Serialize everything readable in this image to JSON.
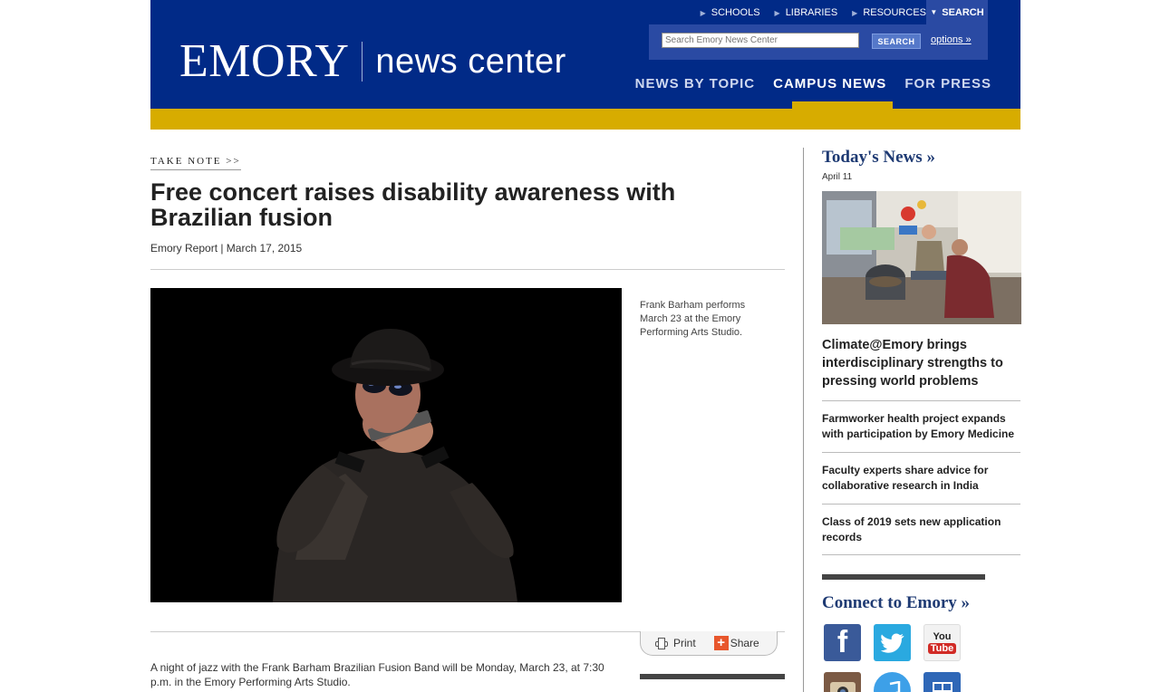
{
  "header": {
    "logo_main": "EMORY",
    "logo_sub": "news center",
    "util_links": [
      "SCHOOLS",
      "LIBRARIES",
      "RESOURCES"
    ],
    "search_tab": "SEARCH",
    "search_placeholder": "Search Emory News Center",
    "search_button": "SEARCH",
    "options_link": "options »",
    "nav": [
      "NEWS BY TOPIC",
      "CAMPUS NEWS",
      "FOR PRESS"
    ],
    "nav_active": "CAMPUS NEWS"
  },
  "article": {
    "kicker": "TAKE NOTE >>",
    "headline": "Free concert raises disability awareness with Brazilian fusion",
    "byline": "Emory Report | March 17, 2015",
    "caption": "Frank Barham performs March 23 at the Emory Performing Arts Studio.",
    "print_label": "Print",
    "share_label": "Share",
    "body": "A night of jazz with the Frank Barham Brazilian Fusion Band will be Monday, March 23, at 7:30 p.m. in the Emory Performing Arts Studio."
  },
  "sidebar": {
    "title": "Today's News »",
    "date": "April 11",
    "lead": "Climate@Emory brings interdisciplinary strengths to pressing world problems",
    "items": [
      "Farmworker health project expands with participation by Emory Medicine",
      "Faculty experts share advice for collaborative research in India",
      "Class of 2019 sets new application records"
    ],
    "connect_title": "Connect to Emory »",
    "social": [
      "facebook-icon",
      "twitter-icon",
      "youtube-icon",
      "instagram-icon",
      "itunes-icon",
      "grid-app-icon"
    ],
    "youtube_text_top": "You",
    "youtube_text_bottom": "Tube"
  },
  "colors": {
    "brand_blue": "#012a87",
    "gold": "#d7ac00",
    "sidebar_title": "#1e3a73"
  }
}
